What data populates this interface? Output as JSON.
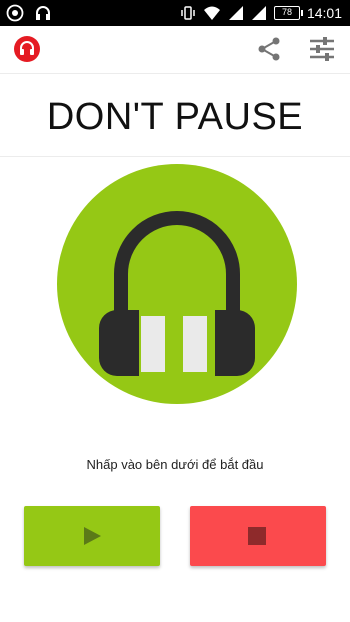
{
  "status_bar": {
    "battery": "78",
    "time": "14:01",
    "left_icons": [
      "chrome-icon",
      "headphones-notification-icon"
    ],
    "right_icons": [
      "vibrate-icon",
      "wifi-icon",
      "signal-icon",
      "signal-icon",
      "battery-icon"
    ]
  },
  "app_bar": {
    "logo_icon": "app-headphones-logo-icon",
    "actions": [
      "share-icon",
      "equalizer-icon"
    ]
  },
  "main": {
    "title": "DON'T PAUSE",
    "hero_icon": "headphones-icon",
    "hint": "Nhấp vào bên dưới để bắt đầu"
  },
  "controls": {
    "play_icon": "play-icon",
    "stop_icon": "stop-icon"
  },
  "colors": {
    "accent_green": "#95c815",
    "stop_red": "#fb4a4d",
    "logo_red": "#e51b23",
    "headphone_dark": "#2b2b2b"
  }
}
